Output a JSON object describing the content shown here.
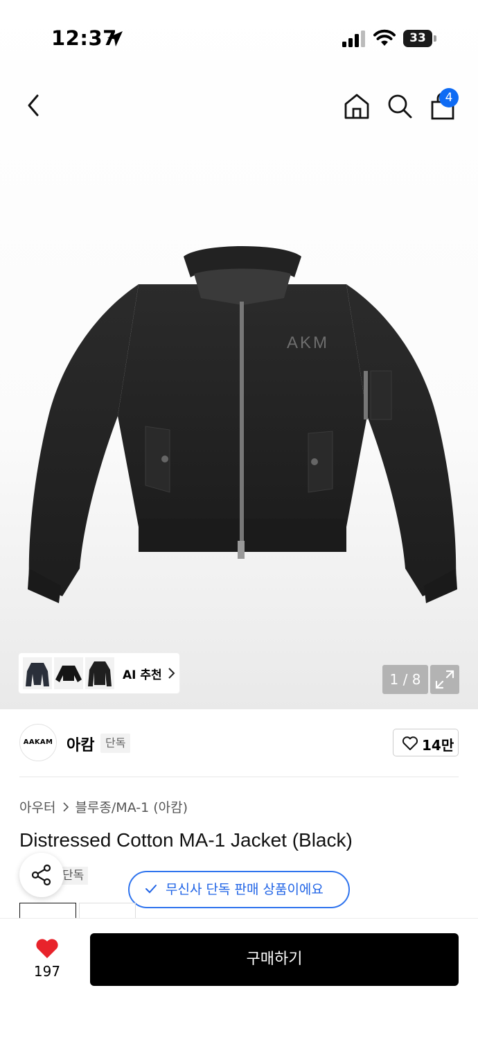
{
  "status_bar": {
    "time": "12:37",
    "battery": "33"
  },
  "nav": {
    "cart_count": "4"
  },
  "gallery": {
    "jacket_print": "AKM",
    "ai_label": "AI 추천",
    "counter": "1 / 8"
  },
  "brand": {
    "logo_text": "AAKAM",
    "name": "아캄",
    "tag": "단독",
    "like_count": "14만"
  },
  "breadcrumb": {
    "category": "아우터",
    "subcategory": "블루종/MA-1 (아캄)"
  },
  "product": {
    "title": "Distressed Cotton MA-1 Jacket (Black)",
    "exclusive_tag": "단독"
  },
  "toast": {
    "text": "무신사 단독 판매 상품이에요"
  },
  "bottom_bar": {
    "wish_count": "197",
    "buy_label": "구매하기"
  },
  "colors": {
    "accent": "#0e6bf4",
    "heart": "#e8232b",
    "buy_button": "#000000"
  }
}
